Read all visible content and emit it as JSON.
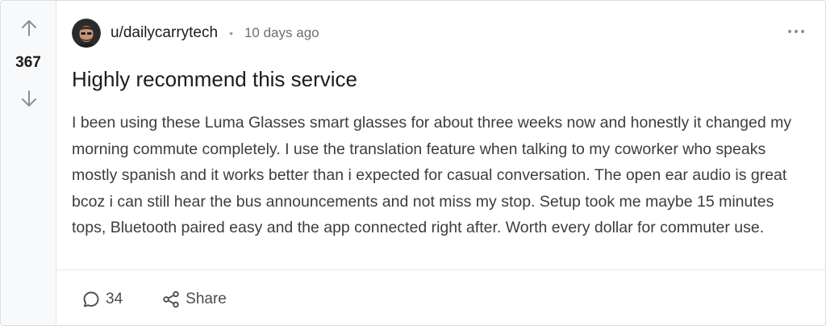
{
  "post": {
    "votes": "367",
    "author": "u/dailycarrytech",
    "separator": "•",
    "time_ago": "10 days ago",
    "title": "Highly recommend this service",
    "body": "I been using these Luma Glasses smart glasses for about three weeks now and honestly it changed my morning commute completely. I use the translation feature when talking to my coworker who speaks mostly spanish and it works better than i expected for casual conversation. The open ear audio is great bcoz i can still hear the bus announcements and not miss my stop. Setup took me maybe 15 minutes tops, Bluetooth paired easy and the app connected right after. Worth every dollar for commuter use."
  },
  "actions": {
    "comments_count": "34",
    "share_label": "Share"
  },
  "icons": {
    "upvote": "arrow-up-icon",
    "downvote": "arrow-down-icon",
    "more": "ellipsis-icon",
    "comment": "speech-bubble-icon",
    "share": "share-icon"
  },
  "colors": {
    "text_primary": "#1c1c1c",
    "text_body": "#3a3d40",
    "text_muted": "#6b7075",
    "vote_column_bg": "#f8f9fa",
    "border": "#d9dde1"
  }
}
